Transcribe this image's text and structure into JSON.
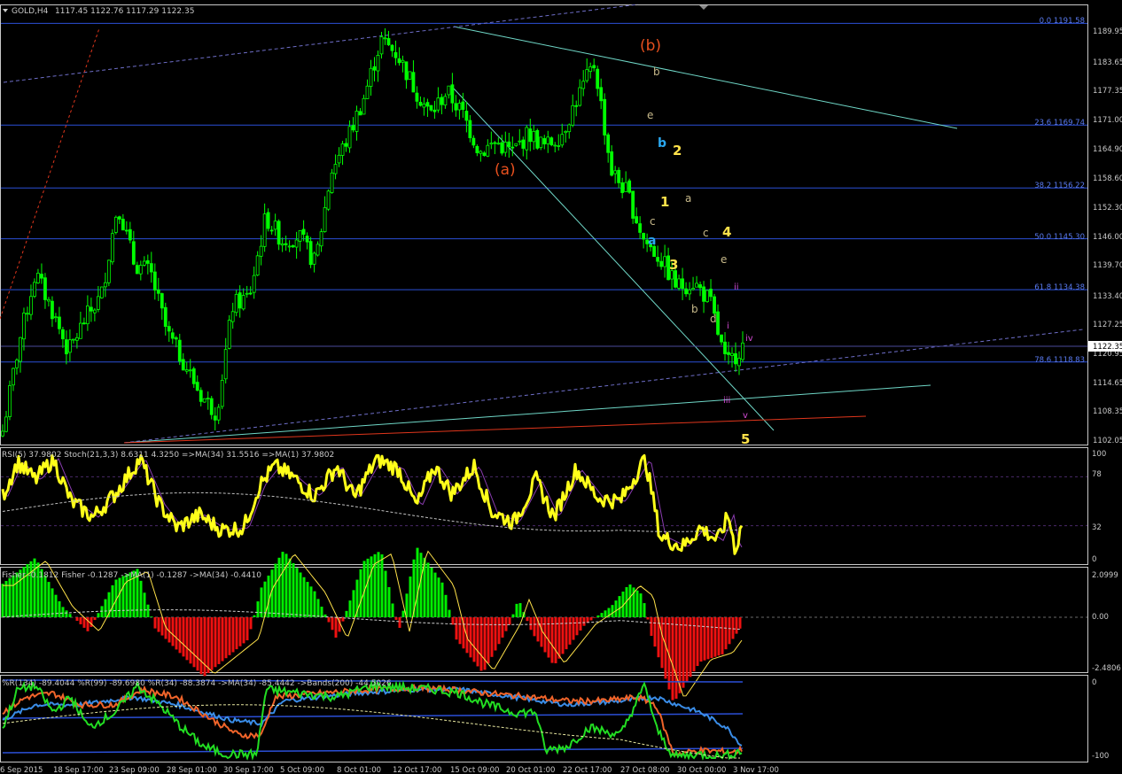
{
  "header": {
    "symbol": "GOLD,H4",
    "ohlc": "1117.45 1122.76 1117.29 1122.35"
  },
  "colors": {
    "background": "#000000",
    "border": "#c8c8c8",
    "candle": "#00ff00",
    "fib_line": "#2b4fd6",
    "trend_line": "#6fd7c7",
    "dashed_line": "#6e6ec8",
    "red_line": "#e0361c",
    "wave_red": "#e8501e",
    "wave_yellow": "#ffe24a",
    "wave_blue": "#2aa8f0",
    "wave_sub": "#c7b98a",
    "wave_magenta": "#d24ad2",
    "rsi_stoch": "#ffff1a",
    "stoch_purple": "#8a3cb0",
    "fisher_pos": "#00ee00",
    "fisher_neg": "#ee1111",
    "fisher_line": "#ffe24a",
    "wpr_green": "#22dd22",
    "wpr_orange": "#f0642a",
    "wpr_blue": "#3a8de8",
    "wpr_band": "#2b4fd6"
  },
  "price_panel": {
    "ticks": [
      "1189.95",
      "1183.65",
      "1177.35",
      "1171.00",
      "1164.90",
      "1158.60",
      "1152.30",
      "1146.00",
      "1139.70",
      "1133.40",
      "1127.25",
      "1120.95",
      "1114.65",
      "1108.35",
      "1102.05"
    ],
    "current_price": "1122.35",
    "fib_levels": [
      {
        "label": "0.0  1191.58",
        "price": 1191.58
      },
      {
        "label": "23.6  1169.74",
        "price": 1169.74
      },
      {
        "label": "38.2  1156.22",
        "price": 1156.22
      },
      {
        "label": "50.0  1145.30",
        "price": 1145.3
      },
      {
        "label": "61.8  1134.38",
        "price": 1134.38
      },
      {
        "label": "78.6  1118.83",
        "price": 1118.83
      }
    ],
    "wave_labels": [
      {
        "text": "(b)",
        "style": "red"
      },
      {
        "text": "(a)",
        "style": "red"
      },
      {
        "text": "b",
        "style": "blue"
      },
      {
        "text": "a",
        "style": "blue"
      },
      {
        "text": "2",
        "style": "yellow"
      },
      {
        "text": "1",
        "style": "yellow"
      },
      {
        "text": "3",
        "style": "yellow"
      },
      {
        "text": "4",
        "style": "yellow"
      },
      {
        "text": "5",
        "style": "yellow"
      },
      {
        "text": "b",
        "style": "sub"
      },
      {
        "text": "e",
        "style": "sub"
      },
      {
        "text": "c",
        "style": "sub"
      },
      {
        "text": "a",
        "style": "sub"
      },
      {
        "text": "c",
        "style": "sub"
      },
      {
        "text": "e",
        "style": "sub"
      },
      {
        "text": "b",
        "style": "sub"
      },
      {
        "text": "d",
        "style": "sub"
      },
      {
        "text": "ii",
        "style": "magenta"
      },
      {
        "text": "i",
        "style": "magenta"
      },
      {
        "text": "iv",
        "style": "magenta"
      },
      {
        "text": "iii",
        "style": "magenta"
      },
      {
        "text": "v",
        "style": "magenta"
      }
    ]
  },
  "rsi_panel": {
    "title": "RSI(5) 37.9802  Stoch(21,3,3) 8.6311 4.3250  =>MA(34) 31.5516  =>MA(1) 37.9802",
    "ticks": [
      "100",
      "78",
      "32",
      "0"
    ]
  },
  "fisher_panel": {
    "title": "Fisher -0.1812  Fisher -0.1287  ->MA(1) -0.1287  ->MA(34) -0.4410",
    "ticks": [
      "2.0999",
      "0.00",
      "-2.4806"
    ]
  },
  "wpr_panel": {
    "title": "%R(134) -89.4044  %R(99) -89.6980  %R(34) -88.3874  ->MA(34) -85.4442  ->Bands(200) -44.5026",
    "ticks": [
      "0",
      "-100"
    ]
  },
  "time_axis": [
    "6 Sep 2015",
    "18 Sep 17:00",
    "23 Sep 09:00",
    "28 Sep 01:00",
    "30 Sep 17:00",
    "5 Oct 09:00",
    "8 Oct 01:00",
    "12 Oct 17:00",
    "15 Oct 09:00",
    "20 Oct 01:00",
    "22 Oct 17:00",
    "27 Oct 08:00",
    "30 Oct 00:00",
    "3 Nov 17:00"
  ],
  "chart_data": {
    "type": "line",
    "title": "GOLD,H4",
    "ylim": [
      1102.05,
      1193.0
    ],
    "x": [
      "6 Sep 2015",
      "18 Sep 17:00",
      "23 Sep 09:00",
      "28 Sep 01:00",
      "30 Sep 17:00",
      "5 Oct 09:00",
      "8 Oct 01:00",
      "12 Oct 17:00",
      "15 Oct 09:00",
      "20 Oct 01:00",
      "22 Oct 17:00",
      "27 Oct 08:00",
      "30 Oct 00:00",
      "3 Nov 17:00"
    ],
    "series": [
      {
        "values": [
          1104.0,
          1123.0,
          1138.0,
          1130.0,
          1121.0,
          1128.0,
          1133.0,
          1153.0,
          1140.0,
          1138.0,
          1125.0,
          1119.0,
          1112.0,
          1108.0,
          1131.0,
          1133.0,
          1150.0,
          1145.0,
          1146.0,
          1140.0,
          1160.0,
          1167.0,
          1176.0,
          1188.0,
          1185.0,
          1178.0,
          1172.0,
          1177.0,
          1172.0,
          1164.0,
          1166.0,
          1164.0,
          1168.0,
          1165.0,
          1168.0,
          1176.0,
          1183.0,
          1160.0,
          1155.0,
          1145.0,
          1141.0,
          1135.0,
          1136.0,
          1132.0,
          1118.0,
          1122.35
        ]
      }
    ]
  }
}
